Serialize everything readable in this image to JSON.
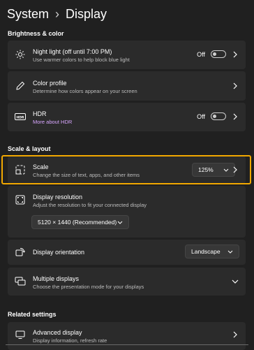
{
  "breadcrumb": {
    "parent": "System",
    "separator": "›",
    "current": "Display"
  },
  "sections": {
    "brightness": "Brightness & color",
    "scale_layout": "Scale & layout",
    "related": "Related settings"
  },
  "night_light": {
    "title": "Night light (off until 7:00 PM)",
    "subtitle": "Use warmer colors to help block blue light",
    "state": "Off"
  },
  "color_profile": {
    "title": "Color profile",
    "subtitle": "Determine how colors appear on your screen"
  },
  "hdr": {
    "title": "HDR",
    "link": "More about HDR",
    "state": "Off"
  },
  "scale": {
    "title": "Scale",
    "subtitle": "Change the size of text, apps, and other items",
    "value": "125%"
  },
  "resolution": {
    "title": "Display resolution",
    "subtitle": "Adjust the resolution to fit your connected display",
    "value": "5120 × 1440 (Recommended)"
  },
  "orientation": {
    "title": "Display orientation",
    "value": "Landscape"
  },
  "multiple": {
    "title": "Multiple displays",
    "subtitle": "Choose the presentation mode for your displays"
  },
  "advanced": {
    "title": "Advanced display",
    "subtitle": "Display information, refresh rate"
  },
  "icons": {
    "night_light": "sun-icon",
    "color_profile": "pen-icon",
    "hdr": "hdr-icon",
    "scale": "scale-icon",
    "resolution": "resolution-icon",
    "orientation": "orientation-icon",
    "multiple": "multiple-displays-icon",
    "advanced": "monitor-icon"
  },
  "colors": {
    "accent_highlight": "#f2a800",
    "link": "#d8a7ff",
    "background": "#202020",
    "card": "#2b2b2b"
  }
}
